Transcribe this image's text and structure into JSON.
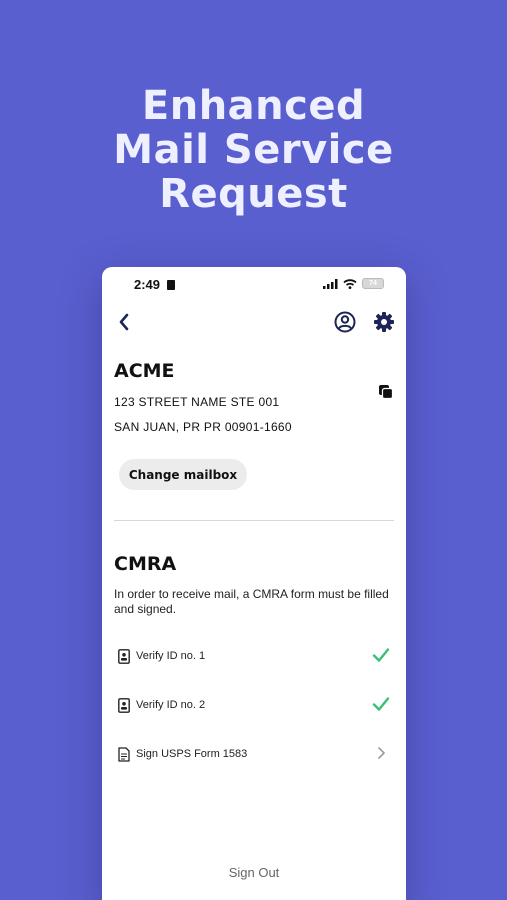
{
  "headline": [
    "Enhanced",
    "Mail Service",
    "Request"
  ],
  "status_bar": {
    "time": "2:49",
    "battery": "74"
  },
  "nav": {
    "back_icon": "chevron-left-icon",
    "profile_icon": "user-circle-icon",
    "settings_icon": "gear-icon"
  },
  "mailbox": {
    "name": "ACME",
    "address_line1": "123 STREET NAME STE 001",
    "address_line2": "SAN JUAN, PR PR 00901-1660",
    "change_label": "Change mailbox",
    "copy_icon": "copy-icon"
  },
  "cmra": {
    "title": "CMRA",
    "description": "In order to receive mail, a CMRA form must be filled and signed.",
    "items": [
      {
        "label": "Verify ID no. 1",
        "icon": "id-card-icon",
        "status": "done"
      },
      {
        "label": "Verify ID no. 2",
        "icon": "id-card-icon",
        "status": "done"
      },
      {
        "label": "Sign USPS Form 1583",
        "icon": "document-icon",
        "status": "pending"
      }
    ]
  },
  "footer": {
    "sign_out": "Sign Out"
  },
  "colors": {
    "background": "#5a5fd0",
    "check": "#3cbf78",
    "icon_dark": "#1d2554"
  }
}
